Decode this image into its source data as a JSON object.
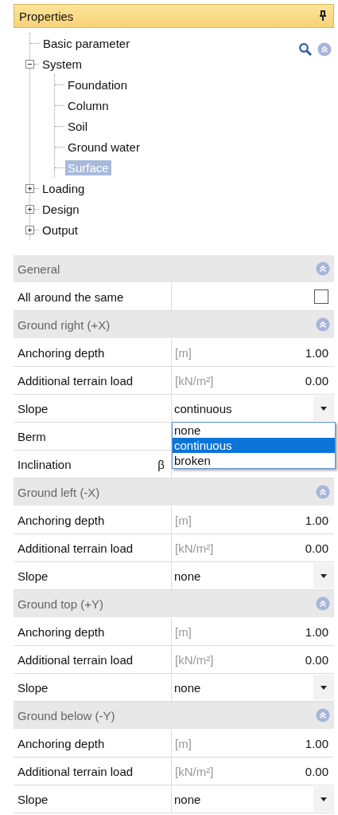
{
  "panel": {
    "title": "Properties"
  },
  "tree": [
    {
      "label": "Basic parameter",
      "selected": false
    },
    {
      "label": "System",
      "expanded": true,
      "selected": false,
      "children": [
        {
          "label": "Foundation",
          "selected": false
        },
        {
          "label": "Column",
          "selected": false
        },
        {
          "label": "Soil",
          "selected": false
        },
        {
          "label": "Ground water",
          "selected": false
        },
        {
          "label": "Surface",
          "selected": true
        }
      ]
    },
    {
      "label": "Loading",
      "expanded": false,
      "selected": false
    },
    {
      "label": "Design",
      "expanded": false,
      "selected": false
    },
    {
      "label": "Output",
      "expanded": false,
      "selected": false
    }
  ],
  "sections": [
    {
      "title": "General",
      "expanded": true,
      "rows": [
        {
          "kind": "checkbox",
          "label": "All around the same",
          "checked": false
        }
      ]
    },
    {
      "title": "Ground right (+X)",
      "expanded": true,
      "rows": [
        {
          "kind": "number",
          "label": "Anchoring depth",
          "unit": "[m]",
          "value": "1.00"
        },
        {
          "kind": "number",
          "label": "Additional terrain load",
          "unit": "[kN/m²]",
          "value": "0.00"
        },
        {
          "kind": "select",
          "label": "Slope",
          "value": "continuous",
          "open": true,
          "options": [
            {
              "label": "none",
              "selected": false
            },
            {
              "label": "continuous",
              "selected": true
            },
            {
              "label": "broken",
              "selected": false
            }
          ]
        },
        {
          "kind": "plain",
          "label": "Berm"
        },
        {
          "kind": "symbol",
          "label": "Inclination",
          "symbol": "β"
        }
      ]
    },
    {
      "title": "Ground left (-X)",
      "expanded": true,
      "rows": [
        {
          "kind": "number",
          "label": "Anchoring depth",
          "unit": "[m]",
          "value": "1.00"
        },
        {
          "kind": "number",
          "label": "Additional terrain load",
          "unit": "[kN/m²]",
          "value": "0.00"
        },
        {
          "kind": "select",
          "label": "Slope",
          "value": "none",
          "open": false
        }
      ]
    },
    {
      "title": "Ground top (+Y)",
      "expanded": true,
      "rows": [
        {
          "kind": "number",
          "label": "Anchoring depth",
          "unit": "[m]",
          "value": "1.00"
        },
        {
          "kind": "number",
          "label": "Additional terrain load",
          "unit": "[kN/m²]",
          "value": "0.00"
        },
        {
          "kind": "select",
          "label": "Slope",
          "value": "none",
          "open": false
        }
      ]
    },
    {
      "title": "Ground below (-Y)",
      "expanded": true,
      "rows": [
        {
          "kind": "number",
          "label": "Anchoring depth",
          "unit": "[m]",
          "value": "1.00"
        },
        {
          "kind": "number",
          "label": "Additional terrain load",
          "unit": "[kN/m²]",
          "value": "0.00"
        },
        {
          "kind": "select",
          "label": "Slope",
          "value": "none",
          "open": false
        }
      ]
    }
  ]
}
